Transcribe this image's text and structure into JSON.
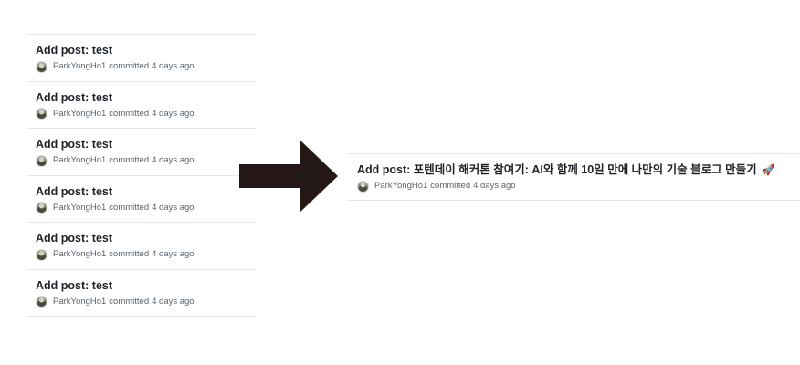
{
  "left_commits": [
    {
      "title": "Add post: test",
      "author": "ParkYongHo1",
      "action": "committed",
      "time": "4 days ago"
    },
    {
      "title": "Add post: test",
      "author": "ParkYongHo1",
      "action": "committed",
      "time": "4 days ago"
    },
    {
      "title": "Add post: test",
      "author": "ParkYongHo1",
      "action": "committed",
      "time": "4 days ago"
    },
    {
      "title": "Add post: test",
      "author": "ParkYongHo1",
      "action": "committed",
      "time": "4 days ago"
    },
    {
      "title": "Add post: test",
      "author": "ParkYongHo1",
      "action": "committed",
      "time": "4 days ago"
    },
    {
      "title": "Add post: test",
      "author": "ParkYongHo1",
      "action": "committed",
      "time": "4 days ago"
    }
  ],
  "right_commit": {
    "title": "Add post: 포텐데이 해커톤 참여기: AI와 함께 10일 만에 나만의 기술 블로그 만들기",
    "emoji": "🚀",
    "author": "ParkYongHo1",
    "action": "committed",
    "time": "4 days ago"
  },
  "arrow": {
    "icon": "right-arrow-icon",
    "color": "#231815"
  }
}
